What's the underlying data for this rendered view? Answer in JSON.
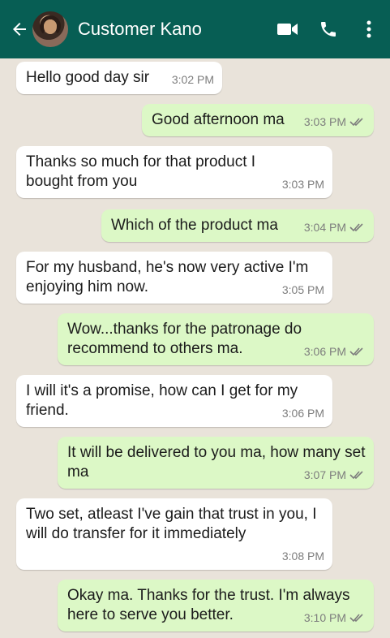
{
  "header": {
    "contact_name": "Customer Kano",
    "bg_color": "#075e54"
  },
  "colors": {
    "incoming_bubble": "#ffffff",
    "outgoing_bubble": "#dcf8c6",
    "chat_background": "#e9e3da",
    "tick_color": "#7d7d7d"
  },
  "messages": [
    {
      "direction": "in",
      "text": "Hello good day sir",
      "time": "3:02 PM"
    },
    {
      "direction": "out",
      "text": "Good afternoon ma",
      "time": "3:03 PM",
      "status": "read"
    },
    {
      "direction": "in",
      "text": "Thanks so much for that product I bought from you",
      "time": "3:03 PM"
    },
    {
      "direction": "out",
      "text": "Which of the product ma",
      "time": "3:04 PM",
      "status": "read"
    },
    {
      "direction": "in",
      "text": "For my husband, he's now very active I'm enjoying him now.",
      "time": "3:05 PM"
    },
    {
      "direction": "out",
      "text": "Wow...thanks for the patronage do recommend to others ma.",
      "time": "3:06 PM",
      "status": "read"
    },
    {
      "direction": "in",
      "text": "I will it's a promise, how can I get for my friend.",
      "time": "3:06 PM"
    },
    {
      "direction": "out",
      "text": "It will be delivered to you ma, how many set ma",
      "time": "3:07 PM",
      "status": "read"
    },
    {
      "direction": "in",
      "text": "Two set, atleast I've gain that trust in you, I will do transfer for it immediately",
      "time": "3:08 PM"
    },
    {
      "direction": "out",
      "text": "Okay ma. Thanks for the trust. I'm always here to serve you better.",
      "time": "3:10 PM",
      "status": "read"
    }
  ],
  "icons": [
    "back-arrow-icon",
    "avatar",
    "video-call-icon",
    "phone-icon",
    "more-options-icon",
    "double-check-icon"
  ]
}
